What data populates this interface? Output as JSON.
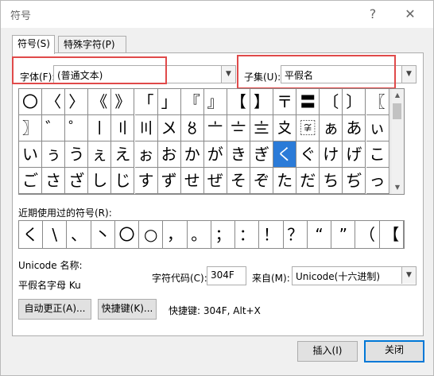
{
  "window": {
    "title": "符号",
    "help_label": "?",
    "close_label": "✕"
  },
  "tabs": [
    {
      "label": "符号(S)"
    },
    {
      "label": "特殊字符(P)"
    }
  ],
  "font": {
    "label": "字体(F):",
    "value": "(普通文本)"
  },
  "subset": {
    "label": "子集(U):",
    "value": "平假名"
  },
  "symbols": [
    [
      "〇",
      "〈",
      "〉",
      "《",
      "》",
      "「",
      "」",
      "『",
      "』",
      "【",
      "】",
      "〒",
      "〓",
      "〔",
      "〕",
      "〖"
    ],
    [
      "〗",
      "゛",
      "゜",
      "〡",
      "〢",
      "〣",
      "〤",
      "〥",
      "〦",
      "〧",
      "〨",
      "〩",
      "〾",
      "ぁ",
      "あ",
      "ぃ"
    ],
    [
      "い",
      "ぅ",
      "う",
      "ぇ",
      "え",
      "ぉ",
      "お",
      "か",
      "が",
      "き",
      "ぎ",
      "く",
      "ぐ",
      "け",
      "げ",
      "こ"
    ],
    [
      "ご",
      "さ",
      "ざ",
      "し",
      "じ",
      "す",
      "ず",
      "せ",
      "ぜ",
      "そ",
      "ぞ",
      "た",
      "だ",
      "ち",
      "ぢ",
      "っ"
    ]
  ],
  "recent": {
    "label": "近期使用过的符号(R):",
    "items": [
      "く",
      "\\",
      "、",
      "丶",
      "〇",
      "○",
      "，",
      "。",
      "；",
      "：",
      "！",
      "？",
      "“",
      "”",
      "（",
      "【"
    ]
  },
  "unicode": {
    "name_label": "Unicode 名称:",
    "name_value": "平假名字母 Ku",
    "code_label": "字符代码(C):",
    "code_value": "304F",
    "from_label": "来自(M):",
    "from_value": "Unicode(十六进制)"
  },
  "buttons": {
    "autocorrect": "自动更正(A)...",
    "shortcut_key": "快捷键(K)...",
    "shortcut_text": "快捷键: 304F, Alt+X",
    "insert": "插入(I)",
    "close": "关闭"
  },
  "colors": {
    "highlight": "#e04a4a",
    "selection": "#2b7bd8",
    "default_button_border": "#0078d7"
  }
}
